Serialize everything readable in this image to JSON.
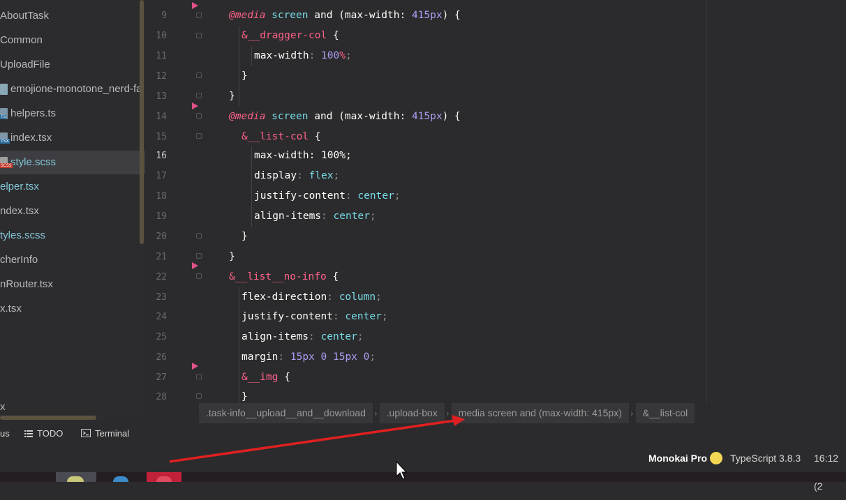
{
  "sidebar": {
    "items": [
      {
        "label": "AboutTask",
        "icon": ""
      },
      {
        "label": "Common",
        "icon": ""
      },
      {
        "label": "UploadFile",
        "icon": ""
      },
      {
        "label": "emojione-monotone_nerd-fa",
        "icon": "svg-file-icon"
      },
      {
        "label": "helpers.ts",
        "icon": "ts-file-icon"
      },
      {
        "label": "index.tsx",
        "icon": "tsx-file-icon"
      },
      {
        "label": "style.scss",
        "icon": "scss-file-icon"
      },
      {
        "label": "elper.tsx",
        "icon": ""
      },
      {
        "label": "ndex.tsx",
        "icon": ""
      },
      {
        "label": "tyles.scss",
        "icon": ""
      },
      {
        "label": "cherInfo",
        "icon": ""
      },
      {
        "label": "nRouter.tsx",
        "icon": ""
      },
      {
        "label": "x.tsx",
        "icon": ""
      },
      {
        "label": "x",
        "icon": ""
      }
    ],
    "icon_tags": {
      "ts": "TS",
      "tsx": "TSX",
      "scss": "SCSS"
    }
  },
  "editor": {
    "current_line": "16",
    "lines": [
      {
        "n": "9"
      },
      {
        "n": "10"
      },
      {
        "n": "11"
      },
      {
        "n": "12"
      },
      {
        "n": "13"
      },
      {
        "n": "14"
      },
      {
        "n": "15"
      },
      {
        "n": "16"
      },
      {
        "n": "17"
      },
      {
        "n": "18"
      },
      {
        "n": "19"
      },
      {
        "n": "20"
      },
      {
        "n": "21"
      },
      {
        "n": "22"
      },
      {
        "n": "23"
      },
      {
        "n": "24"
      },
      {
        "n": "25"
      },
      {
        "n": "26"
      },
      {
        "n": "27"
      },
      {
        "n": "28"
      }
    ],
    "code": {
      "l9_at": "@media",
      "l9_rest1": " screen ",
      "l9_and": "and",
      "l9_rest2": " (max-width: ",
      "l9_num": "415px",
      "l9_end": ") {",
      "l10_sel": "&__dragger-col",
      "l10_end": " {",
      "l11_prop": "max-width",
      "l11_colon": ": ",
      "l11_num": "100",
      "l11_pct": "%",
      "l11_semi": ";",
      "l12": "}",
      "l13": "}",
      "l14_at": "@media",
      "l14_rest1": " screen ",
      "l14_and": "and",
      "l14_rest2": " (max-width: ",
      "l14_num": "415px",
      "l14_end": ") {",
      "l15_sel": "&__list-col",
      "l15_end": " {",
      "l16": "max-width: 100%;",
      "l17_prop": "display",
      "l17_colon": ": ",
      "l17_val": "flex",
      "l17_semi": ";",
      "l18_prop": "justify-content",
      "l18_colon": ": ",
      "l18_val": "center",
      "l18_semi": ";",
      "l19_prop": "align-items",
      "l19_colon": ": ",
      "l19_val": "center",
      "l19_semi": ";",
      "l20": "}",
      "l21": "}",
      "l22_sel": "&__list__no-info",
      "l22_end": " {",
      "l23_prop": "flex-direction",
      "l23_colon": ": ",
      "l23_val": "column",
      "l23_semi": ";",
      "l24_prop": "justify-content",
      "l24_colon": ": ",
      "l24_val": "center",
      "l24_semi": ";",
      "l25_prop": "align-items",
      "l25_colon": ": ",
      "l25_val": "center",
      "l25_semi": ";",
      "l26_prop": "margin",
      "l26_colon": ": ",
      "l26_v1": "15px",
      "l26_v2": " 0 ",
      "l26_v3": "15px",
      "l26_v4": " 0",
      "l26_semi": ";",
      "l27_sel": "&__img",
      "l27_end": " {",
      "l28": "}"
    }
  },
  "breadcrumb": [
    ".task-info__upload__and__download",
    ".upload-box",
    "media screen and (max-width: 415px)",
    "&__list-col"
  ],
  "toolbar": {
    "partial_label": "us",
    "todo_label": "TODO",
    "terminal_label": "Terminal"
  },
  "statusbar": {
    "theme": "Monokai Pro",
    "language": "TypeScript 3.8.3",
    "time": "16:12 (2"
  },
  "colors": {
    "at_rule": "#ff6188",
    "selector": "#ff6188",
    "keyword_value": "#78dce8",
    "number": "#ab9df2",
    "annotation_arrow": "#e02020"
  }
}
